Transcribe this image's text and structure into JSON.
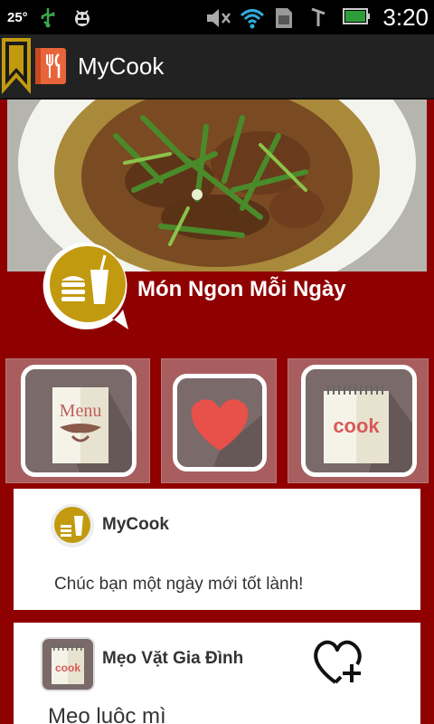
{
  "status_bar": {
    "temperature": "25°",
    "time": "3:20"
  },
  "action_bar": {
    "title": "MyCook"
  },
  "hero": {
    "title": "Món Ngon Mỗi Ngày"
  },
  "tiles": [
    {
      "name": "menu",
      "label": "Menu"
    },
    {
      "name": "favorites",
      "label": ""
    },
    {
      "name": "cook",
      "label": "cook"
    }
  ],
  "cards": [
    {
      "author": "MyCook",
      "text": "Chúc bạn một ngày mới tốt lành!"
    },
    {
      "author": "Mẹo Vặt Gia Đình",
      "text": "Mẹo luộc mì"
    }
  ],
  "colors": {
    "background": "#8f0000",
    "action_bar": "#222222",
    "accent_gold": "#c29a0f",
    "heart_red": "#e8504a"
  }
}
